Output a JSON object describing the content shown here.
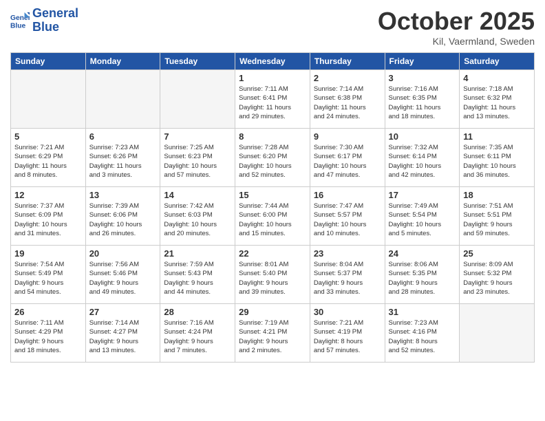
{
  "header": {
    "logo_line1": "General",
    "logo_line2": "Blue",
    "month": "October 2025",
    "location": "Kil, Vaermland, Sweden"
  },
  "weekdays": [
    "Sunday",
    "Monday",
    "Tuesday",
    "Wednesday",
    "Thursday",
    "Friday",
    "Saturday"
  ],
  "weeks": [
    [
      {
        "day": "",
        "info": "",
        "empty": true
      },
      {
        "day": "",
        "info": "",
        "empty": true
      },
      {
        "day": "",
        "info": "",
        "empty": true
      },
      {
        "day": "1",
        "info": "Sunrise: 7:11 AM\nSunset: 6:41 PM\nDaylight: 11 hours\nand 29 minutes."
      },
      {
        "day": "2",
        "info": "Sunrise: 7:14 AM\nSunset: 6:38 PM\nDaylight: 11 hours\nand 24 minutes."
      },
      {
        "day": "3",
        "info": "Sunrise: 7:16 AM\nSunset: 6:35 PM\nDaylight: 11 hours\nand 18 minutes."
      },
      {
        "day": "4",
        "info": "Sunrise: 7:18 AM\nSunset: 6:32 PM\nDaylight: 11 hours\nand 13 minutes."
      }
    ],
    [
      {
        "day": "5",
        "info": "Sunrise: 7:21 AM\nSunset: 6:29 PM\nDaylight: 11 hours\nand 8 minutes."
      },
      {
        "day": "6",
        "info": "Sunrise: 7:23 AM\nSunset: 6:26 PM\nDaylight: 11 hours\nand 3 minutes."
      },
      {
        "day": "7",
        "info": "Sunrise: 7:25 AM\nSunset: 6:23 PM\nDaylight: 10 hours\nand 57 minutes."
      },
      {
        "day": "8",
        "info": "Sunrise: 7:28 AM\nSunset: 6:20 PM\nDaylight: 10 hours\nand 52 minutes."
      },
      {
        "day": "9",
        "info": "Sunrise: 7:30 AM\nSunset: 6:17 PM\nDaylight: 10 hours\nand 47 minutes."
      },
      {
        "day": "10",
        "info": "Sunrise: 7:32 AM\nSunset: 6:14 PM\nDaylight: 10 hours\nand 42 minutes."
      },
      {
        "day": "11",
        "info": "Sunrise: 7:35 AM\nSunset: 6:11 PM\nDaylight: 10 hours\nand 36 minutes."
      }
    ],
    [
      {
        "day": "12",
        "info": "Sunrise: 7:37 AM\nSunset: 6:09 PM\nDaylight: 10 hours\nand 31 minutes."
      },
      {
        "day": "13",
        "info": "Sunrise: 7:39 AM\nSunset: 6:06 PM\nDaylight: 10 hours\nand 26 minutes."
      },
      {
        "day": "14",
        "info": "Sunrise: 7:42 AM\nSunset: 6:03 PM\nDaylight: 10 hours\nand 20 minutes."
      },
      {
        "day": "15",
        "info": "Sunrise: 7:44 AM\nSunset: 6:00 PM\nDaylight: 10 hours\nand 15 minutes."
      },
      {
        "day": "16",
        "info": "Sunrise: 7:47 AM\nSunset: 5:57 PM\nDaylight: 10 hours\nand 10 minutes."
      },
      {
        "day": "17",
        "info": "Sunrise: 7:49 AM\nSunset: 5:54 PM\nDaylight: 10 hours\nand 5 minutes."
      },
      {
        "day": "18",
        "info": "Sunrise: 7:51 AM\nSunset: 5:51 PM\nDaylight: 9 hours\nand 59 minutes."
      }
    ],
    [
      {
        "day": "19",
        "info": "Sunrise: 7:54 AM\nSunset: 5:49 PM\nDaylight: 9 hours\nand 54 minutes."
      },
      {
        "day": "20",
        "info": "Sunrise: 7:56 AM\nSunset: 5:46 PM\nDaylight: 9 hours\nand 49 minutes."
      },
      {
        "day": "21",
        "info": "Sunrise: 7:59 AM\nSunset: 5:43 PM\nDaylight: 9 hours\nand 44 minutes."
      },
      {
        "day": "22",
        "info": "Sunrise: 8:01 AM\nSunset: 5:40 PM\nDaylight: 9 hours\nand 39 minutes."
      },
      {
        "day": "23",
        "info": "Sunrise: 8:04 AM\nSunset: 5:37 PM\nDaylight: 9 hours\nand 33 minutes."
      },
      {
        "day": "24",
        "info": "Sunrise: 8:06 AM\nSunset: 5:35 PM\nDaylight: 9 hours\nand 28 minutes."
      },
      {
        "day": "25",
        "info": "Sunrise: 8:09 AM\nSunset: 5:32 PM\nDaylight: 9 hours\nand 23 minutes."
      }
    ],
    [
      {
        "day": "26",
        "info": "Sunrise: 7:11 AM\nSunset: 4:29 PM\nDaylight: 9 hours\nand 18 minutes."
      },
      {
        "day": "27",
        "info": "Sunrise: 7:14 AM\nSunset: 4:27 PM\nDaylight: 9 hours\nand 13 minutes."
      },
      {
        "day": "28",
        "info": "Sunrise: 7:16 AM\nSunset: 4:24 PM\nDaylight: 9 hours\nand 7 minutes."
      },
      {
        "day": "29",
        "info": "Sunrise: 7:19 AM\nSunset: 4:21 PM\nDaylight: 9 hours\nand 2 minutes."
      },
      {
        "day": "30",
        "info": "Sunrise: 7:21 AM\nSunset: 4:19 PM\nDaylight: 8 hours\nand 57 minutes."
      },
      {
        "day": "31",
        "info": "Sunrise: 7:23 AM\nSunset: 4:16 PM\nDaylight: 8 hours\nand 52 minutes."
      },
      {
        "day": "",
        "info": "",
        "empty": true
      }
    ]
  ]
}
